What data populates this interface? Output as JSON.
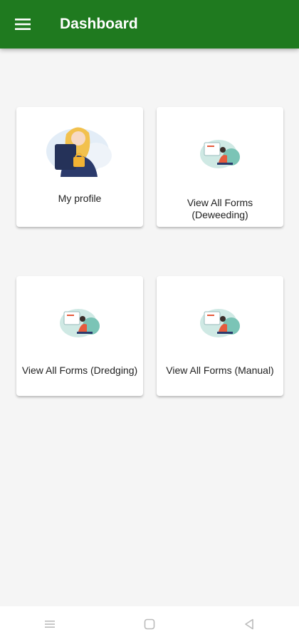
{
  "app": {
    "title": "Dashboard",
    "accent_color": "#1f7a1f"
  },
  "cards": [
    {
      "label": "My profile",
      "icon": "profile-illustration-icon"
    },
    {
      "label_line1": "View All Forms",
      "label_line2": "(Deweeding)",
      "icon": "forms-illustration-icon"
    },
    {
      "label": "View All Forms (Dredging)",
      "icon": "forms-illustration-icon"
    },
    {
      "label": "View All Forms (Manual)",
      "icon": "forms-illustration-icon"
    }
  ],
  "system_nav": {
    "icons": [
      "recent-apps-icon",
      "home-icon",
      "back-icon"
    ]
  }
}
